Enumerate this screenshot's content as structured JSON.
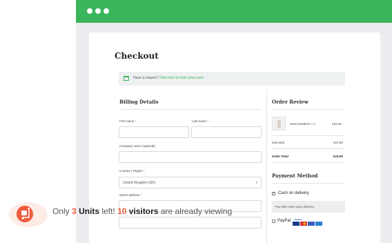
{
  "checkout": {
    "title": "Checkout",
    "coupon_text": "Have a coupon?",
    "coupon_link": "Click here to enter your code"
  },
  "billing": {
    "title": "Billing Details",
    "first_name": "First name",
    "last_name": "Last name",
    "company_name": "Company name (optional)",
    "country_label": "Country / Region",
    "country_value": "United Kingdom (UK)",
    "street_address": "Street address",
    "required_mark": "*"
  },
  "order": {
    "title": "Order Review",
    "product_name": "Hand Sanitizer",
    "product_qty": "× 1",
    "product_price": "£15.00",
    "subtotal_label": "Sub-total",
    "subtotal_value": "£15.00",
    "total_label": "Order Total",
    "total_value": "£15.00"
  },
  "payment": {
    "title": "Payment Method",
    "cod_label": "Cash on delivery",
    "cod_selected": true,
    "cod_desc": "Pay with cash upon delivery.",
    "paypal_label": "PayPal"
  },
  "notice": {
    "prefix": "Only",
    "units_count": "3",
    "units_label": "Units",
    "mid": "left!",
    "visitors_count": "10",
    "visitors_label": "visitors",
    "suffix": "are already viewing"
  },
  "colors": {
    "accent": "#3bb55c",
    "highlight": "#ef5a3c"
  }
}
